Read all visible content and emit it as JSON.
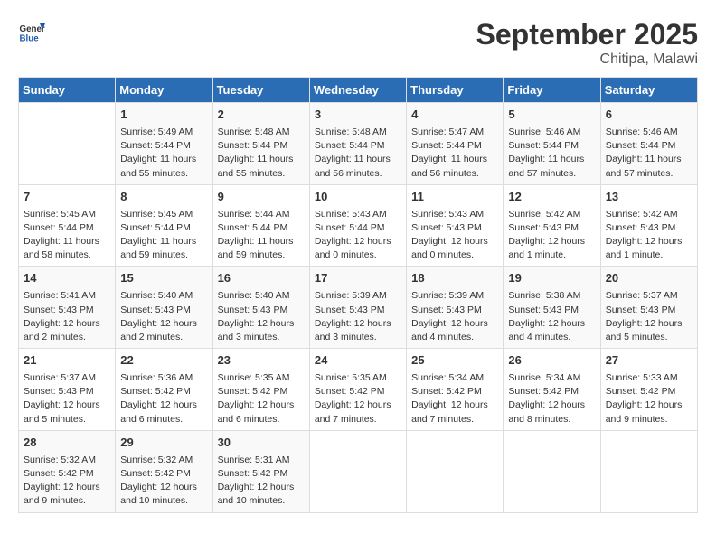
{
  "header": {
    "logo_line1": "General",
    "logo_line2": "Blue",
    "month_year": "September 2025",
    "location": "Chitipa, Malawi"
  },
  "days_of_week": [
    "Sunday",
    "Monday",
    "Tuesday",
    "Wednesday",
    "Thursday",
    "Friday",
    "Saturday"
  ],
  "weeks": [
    [
      {
        "day": "",
        "info": ""
      },
      {
        "day": "1",
        "info": "Sunrise: 5:49 AM\nSunset: 5:44 PM\nDaylight: 11 hours\nand 55 minutes."
      },
      {
        "day": "2",
        "info": "Sunrise: 5:48 AM\nSunset: 5:44 PM\nDaylight: 11 hours\nand 55 minutes."
      },
      {
        "day": "3",
        "info": "Sunrise: 5:48 AM\nSunset: 5:44 PM\nDaylight: 11 hours\nand 56 minutes."
      },
      {
        "day": "4",
        "info": "Sunrise: 5:47 AM\nSunset: 5:44 PM\nDaylight: 11 hours\nand 56 minutes."
      },
      {
        "day": "5",
        "info": "Sunrise: 5:46 AM\nSunset: 5:44 PM\nDaylight: 11 hours\nand 57 minutes."
      },
      {
        "day": "6",
        "info": "Sunrise: 5:46 AM\nSunset: 5:44 PM\nDaylight: 11 hours\nand 57 minutes."
      }
    ],
    [
      {
        "day": "7",
        "info": "Sunrise: 5:45 AM\nSunset: 5:44 PM\nDaylight: 11 hours\nand 58 minutes."
      },
      {
        "day": "8",
        "info": "Sunrise: 5:45 AM\nSunset: 5:44 PM\nDaylight: 11 hours\nand 59 minutes."
      },
      {
        "day": "9",
        "info": "Sunrise: 5:44 AM\nSunset: 5:44 PM\nDaylight: 11 hours\nand 59 minutes."
      },
      {
        "day": "10",
        "info": "Sunrise: 5:43 AM\nSunset: 5:44 PM\nDaylight: 12 hours\nand 0 minutes."
      },
      {
        "day": "11",
        "info": "Sunrise: 5:43 AM\nSunset: 5:43 PM\nDaylight: 12 hours\nand 0 minutes."
      },
      {
        "day": "12",
        "info": "Sunrise: 5:42 AM\nSunset: 5:43 PM\nDaylight: 12 hours\nand 1 minute."
      },
      {
        "day": "13",
        "info": "Sunrise: 5:42 AM\nSunset: 5:43 PM\nDaylight: 12 hours\nand 1 minute."
      }
    ],
    [
      {
        "day": "14",
        "info": "Sunrise: 5:41 AM\nSunset: 5:43 PM\nDaylight: 12 hours\nand 2 minutes."
      },
      {
        "day": "15",
        "info": "Sunrise: 5:40 AM\nSunset: 5:43 PM\nDaylight: 12 hours\nand 2 minutes."
      },
      {
        "day": "16",
        "info": "Sunrise: 5:40 AM\nSunset: 5:43 PM\nDaylight: 12 hours\nand 3 minutes."
      },
      {
        "day": "17",
        "info": "Sunrise: 5:39 AM\nSunset: 5:43 PM\nDaylight: 12 hours\nand 3 minutes."
      },
      {
        "day": "18",
        "info": "Sunrise: 5:39 AM\nSunset: 5:43 PM\nDaylight: 12 hours\nand 4 minutes."
      },
      {
        "day": "19",
        "info": "Sunrise: 5:38 AM\nSunset: 5:43 PM\nDaylight: 12 hours\nand 4 minutes."
      },
      {
        "day": "20",
        "info": "Sunrise: 5:37 AM\nSunset: 5:43 PM\nDaylight: 12 hours\nand 5 minutes."
      }
    ],
    [
      {
        "day": "21",
        "info": "Sunrise: 5:37 AM\nSunset: 5:43 PM\nDaylight: 12 hours\nand 5 minutes."
      },
      {
        "day": "22",
        "info": "Sunrise: 5:36 AM\nSunset: 5:42 PM\nDaylight: 12 hours\nand 6 minutes."
      },
      {
        "day": "23",
        "info": "Sunrise: 5:35 AM\nSunset: 5:42 PM\nDaylight: 12 hours\nand 6 minutes."
      },
      {
        "day": "24",
        "info": "Sunrise: 5:35 AM\nSunset: 5:42 PM\nDaylight: 12 hours\nand 7 minutes."
      },
      {
        "day": "25",
        "info": "Sunrise: 5:34 AM\nSunset: 5:42 PM\nDaylight: 12 hours\nand 7 minutes."
      },
      {
        "day": "26",
        "info": "Sunrise: 5:34 AM\nSunset: 5:42 PM\nDaylight: 12 hours\nand 8 minutes."
      },
      {
        "day": "27",
        "info": "Sunrise: 5:33 AM\nSunset: 5:42 PM\nDaylight: 12 hours\nand 9 minutes."
      }
    ],
    [
      {
        "day": "28",
        "info": "Sunrise: 5:32 AM\nSunset: 5:42 PM\nDaylight: 12 hours\nand 9 minutes."
      },
      {
        "day": "29",
        "info": "Sunrise: 5:32 AM\nSunset: 5:42 PM\nDaylight: 12 hours\nand 10 minutes."
      },
      {
        "day": "30",
        "info": "Sunrise: 5:31 AM\nSunset: 5:42 PM\nDaylight: 12 hours\nand 10 minutes."
      },
      {
        "day": "",
        "info": ""
      },
      {
        "day": "",
        "info": ""
      },
      {
        "day": "",
        "info": ""
      },
      {
        "day": "",
        "info": ""
      }
    ]
  ]
}
